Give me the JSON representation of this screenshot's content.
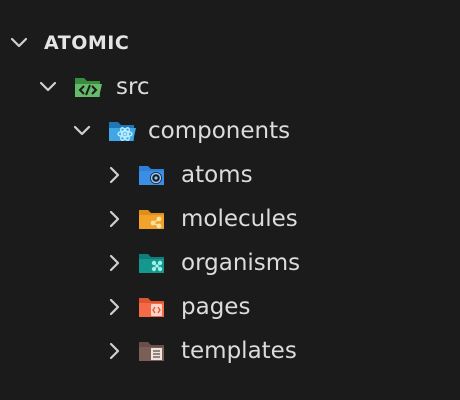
{
  "explorer": {
    "root": {
      "label": "ATOMIC",
      "expanded": true,
      "chevron_icon": "chevron-down-icon"
    },
    "src": {
      "label": "src",
      "expanded": true,
      "icon": "folder-src-open-icon",
      "icon_color": "#4caf50"
    },
    "components": {
      "label": "components",
      "expanded": true,
      "icon": "folder-components-open-icon",
      "icon_color": "#2b8fd6"
    },
    "children": [
      {
        "label": "atoms",
        "expanded": false,
        "icon": "folder-atoms-icon",
        "icon_color": "#2f7fd8"
      },
      {
        "label": "molecules",
        "expanded": false,
        "icon": "folder-molecules-icon",
        "icon_color": "#f0a22b"
      },
      {
        "label": "organisms",
        "expanded": false,
        "icon": "folder-organisms-icon",
        "icon_color": "#14978f"
      },
      {
        "label": "pages",
        "expanded": false,
        "icon": "folder-pages-icon",
        "icon_color": "#f26b46"
      },
      {
        "label": "templates",
        "expanded": false,
        "icon": "folder-templates-icon",
        "icon_color": "#7b5e57"
      }
    ]
  }
}
